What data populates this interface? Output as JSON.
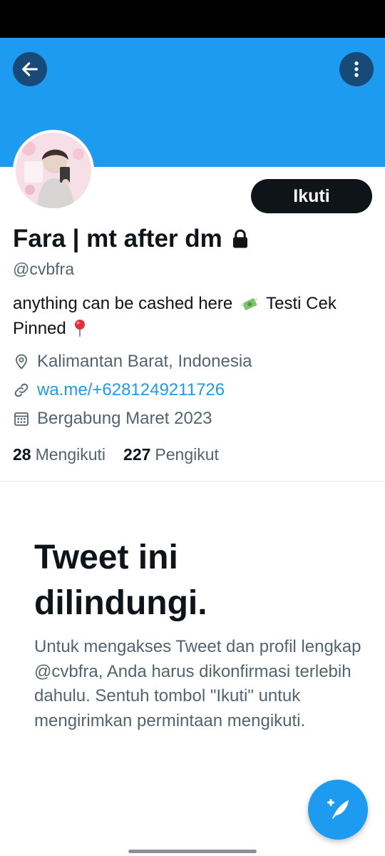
{
  "profile": {
    "display_name": "Fara | mt after dm",
    "handle": "@cvbfra",
    "bio_line1": "anything can be cashed here",
    "bio_line1_tail": "Testi Cek",
    "bio_line2": "Pinned",
    "location": "Kalimantan Barat, Indonesia",
    "website": "wa.me/+6281249211726",
    "joined": "Bergabung Maret 2023",
    "following_count": "28",
    "following_label": "Mengikuti",
    "followers_count": "227",
    "followers_label": "Pengikut"
  },
  "actions": {
    "follow_label": "Ikuti"
  },
  "protected": {
    "title": "Tweet ini dilindungi.",
    "body": "Untuk mengakses Tweet dan profil lengkap @cvbfra, Anda harus dikonfirmasi terlebih dahulu. Sentuh tombol \"Ikuti\" untuk mengirimkan permintaan mengikuti."
  },
  "icons": {
    "back": "arrow-left-icon",
    "more": "more-vertical-icon",
    "lock": "lock-icon",
    "money": "money-with-wings-emoji",
    "pin": "round-pushpin-emoji",
    "location": "location-pin-icon",
    "link": "link-icon",
    "calendar": "calendar-icon",
    "compose": "compose-feather-icon"
  },
  "colors": {
    "brand": "#1d9bf0",
    "text": "#0f1419",
    "secondary": "#536471",
    "header_button": "#184a78"
  }
}
